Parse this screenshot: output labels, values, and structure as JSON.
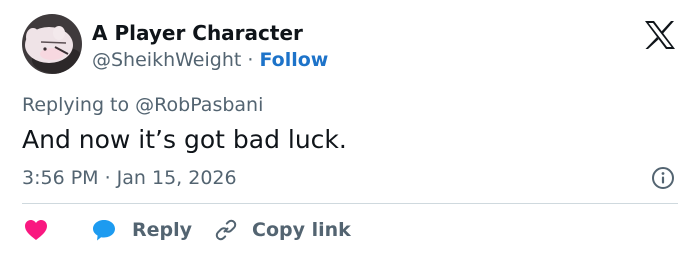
{
  "tweet": {
    "author_name": "A Player Character",
    "author_handle": "@SheikhWeight",
    "separator": "·",
    "follow_label": "Follow",
    "replying_prefix": "Replying to",
    "replying_to": "@RobPasbani",
    "text": "And now it’s got bad luck.",
    "timestamp": "3:56 PM · Jan 15, 2026"
  },
  "actions": {
    "like_label": "",
    "reply_label": "Reply",
    "copy_label": "Copy link"
  },
  "icons": {
    "brand": "x-logo-icon",
    "info": "info-icon",
    "like": "heart-icon",
    "reply": "speech-bubble-icon",
    "copy": "link-icon"
  },
  "colors": {
    "text": "#0f1419",
    "secondary": "#536471",
    "follow": "#1d73c9",
    "like": "#f91880",
    "reply": "#1d9bf0",
    "divider": "#cfd9de"
  }
}
